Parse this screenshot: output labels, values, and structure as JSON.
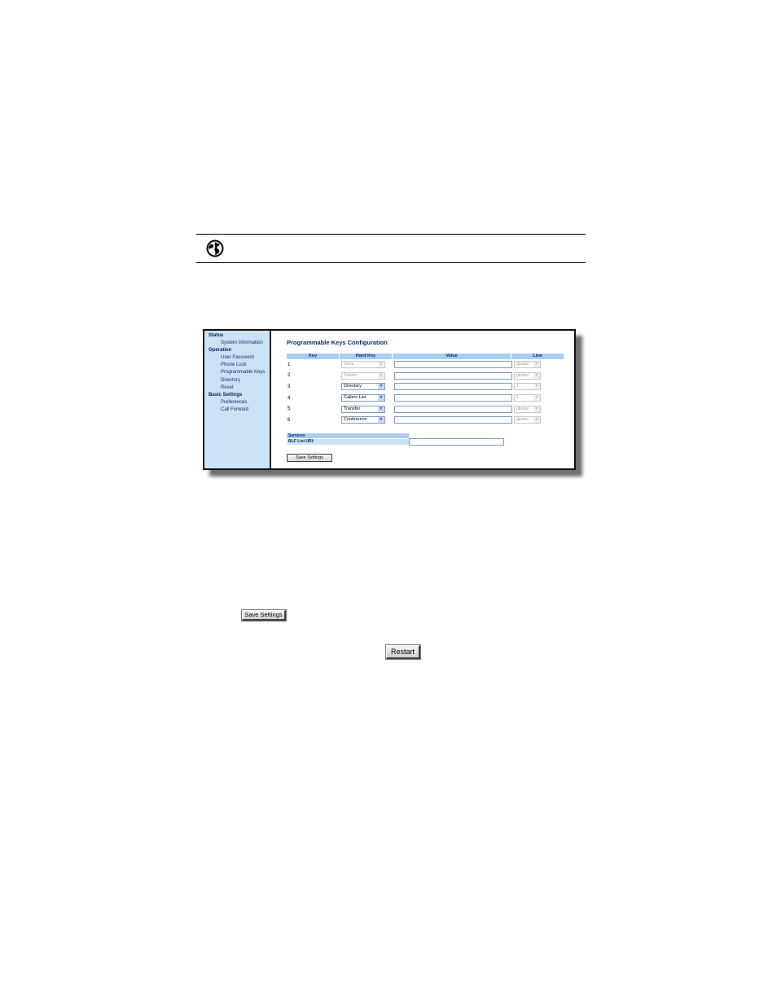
{
  "nav": [
    {
      "type": "head",
      "label": "Status"
    },
    {
      "type": "item",
      "label": "System Information"
    },
    {
      "type": "head",
      "label": "Operation"
    },
    {
      "type": "item",
      "label": "User Password"
    },
    {
      "type": "item",
      "label": "Phone Lock"
    },
    {
      "type": "item",
      "label": "Programmable Keys"
    },
    {
      "type": "item",
      "label": "Directory"
    },
    {
      "type": "item",
      "label": "Reset"
    },
    {
      "type": "head",
      "label": "Basic Settings"
    },
    {
      "type": "item",
      "label": "Preferences"
    },
    {
      "type": "item",
      "label": "Call Forward"
    }
  ],
  "page_title": "Programmable Keys Configuration",
  "table_headers": {
    "key": "Key",
    "hard_key": "Hard Key",
    "value": "Value",
    "line": "Line"
  },
  "rows": [
    {
      "key": "1",
      "hard_key": "Save",
      "hard_disabled": true,
      "value": "",
      "line": "global",
      "line_disabled": true
    },
    {
      "key": "2",
      "hard_key": "Delete",
      "hard_disabled": true,
      "value": "",
      "line": "global",
      "line_disabled": true
    },
    {
      "key": "3",
      "hard_key": "Directory",
      "hard_disabled": false,
      "value": "",
      "line": "1",
      "line_disabled": true
    },
    {
      "key": "4",
      "hard_key": "Callers List",
      "hard_disabled": false,
      "value": "",
      "line": "1",
      "line_disabled": true
    },
    {
      "key": "5",
      "hard_key": "Transfer",
      "hard_disabled": false,
      "value": "",
      "line": "global",
      "line_disabled": true
    },
    {
      "key": "6",
      "hard_key": "Conference",
      "hard_disabled": false,
      "value": "",
      "line": "global",
      "line_disabled": true
    }
  ],
  "services": {
    "header": "Services",
    "blf_label": "BLF List URI:",
    "blf_value": ""
  },
  "inner_save_label": "Save Settings",
  "save_settings_image_label": "Save Settings",
  "restart_image_label": "Restart",
  "icons": {
    "note": "globe-icon"
  },
  "colors": {
    "nav_bg": "#cce3f6",
    "header_bg": "#a8cdf2",
    "title": "#0b2a70"
  }
}
